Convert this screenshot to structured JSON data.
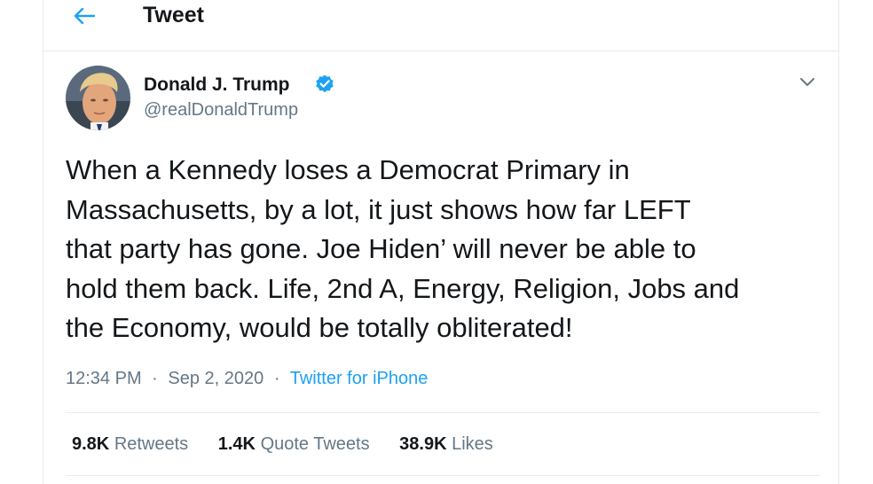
{
  "header": {
    "title": "Tweet",
    "back_icon": "arrow-left-icon",
    "accent_color": "#1da1f2"
  },
  "tweet": {
    "author_name": "Donald J. Trump",
    "author_handle": "@realDonaldTrump",
    "verified": true,
    "text": "When a Kennedy loses a Democrat Primary in\nMassachusetts, by a lot, it just shows how far LEFT\nthat party has gone. Joe Hiden’ will never be able to\nhold them back. Life, 2nd A, Energy, Religion, Jobs and\nthe Economy, would be totally obliterated!",
    "time": "12:34 PM",
    "date": "Sep 2, 2020",
    "source": "Twitter for iPhone",
    "separator": "·"
  },
  "stats": {
    "retweets_count": "9.8K",
    "retweets_label": "Retweets",
    "quotes_count": "1.4K",
    "quotes_label": "Quote Tweets",
    "likes_count": "38.9K",
    "likes_label": "Likes"
  }
}
